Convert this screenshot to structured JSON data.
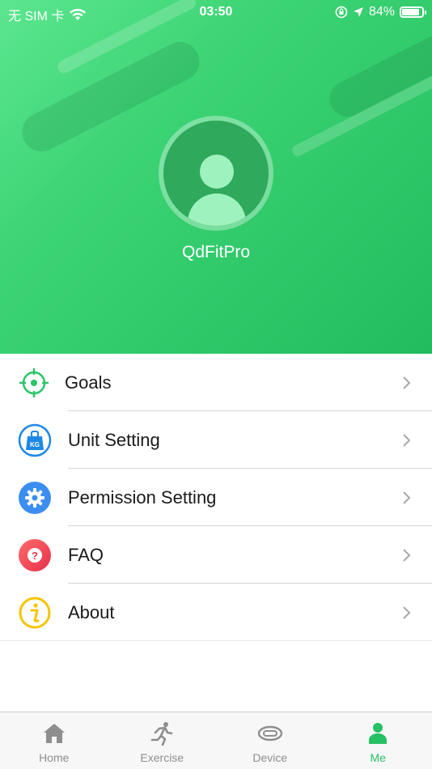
{
  "status_bar": {
    "carrier": "无 SIM 卡",
    "time": "03:50",
    "battery": "84%",
    "battery_level": 0.84
  },
  "profile": {
    "username": "QdFitPro"
  },
  "menu": {
    "items": [
      {
        "label": "Goals",
        "icon": "target-icon",
        "color": "#2ec46a"
      },
      {
        "label": "Unit Setting",
        "icon": "kg-weight-icon",
        "color": "#1e88e5"
      },
      {
        "label": "Permission Setting",
        "icon": "gear-icon",
        "color": "#3b8ef0"
      },
      {
        "label": "FAQ",
        "icon": "question-icon",
        "color": "#f04a56"
      },
      {
        "label": "About",
        "icon": "info-icon",
        "color": "#f5c400"
      }
    ]
  },
  "tab_bar": {
    "tabs": [
      {
        "label": "Home",
        "icon": "home-icon",
        "active": false
      },
      {
        "label": "Exercise",
        "icon": "running-icon",
        "active": false
      },
      {
        "label": "Device",
        "icon": "band-icon",
        "active": false
      },
      {
        "label": "Me",
        "icon": "person-icon",
        "active": true
      }
    ],
    "active_color": "#27c063",
    "inactive_color": "#8e8e8e"
  }
}
